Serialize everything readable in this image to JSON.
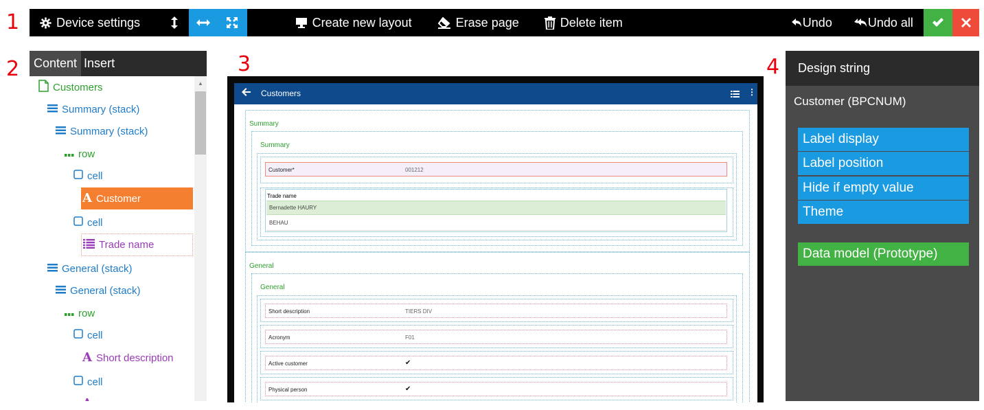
{
  "callouts": [
    "1",
    "2",
    "3",
    "4"
  ],
  "toolbar": {
    "device_settings": "Device settings",
    "create_layout": "Create new layout",
    "erase_page": "Erase page",
    "delete_item": "Delete item",
    "undo": "Undo",
    "undo_all": "Undo all"
  },
  "left_panel": {
    "tabs": [
      "Content",
      "Insert"
    ],
    "tree": [
      {
        "label": "Customers",
        "icon": "page-icon",
        "color": "#2ea02e"
      },
      {
        "label": "Summary (stack)",
        "icon": "stack-icon",
        "color": "#1f7cc9"
      },
      {
        "label": "Summary (stack)",
        "icon": "stack-icon",
        "color": "#1f7cc9"
      },
      {
        "label": "row",
        "icon": "row-icon",
        "color": "#2ea02e"
      },
      {
        "label": "cell",
        "icon": "cell-icon",
        "color": "#1f7cc9"
      },
      {
        "label": "Customer",
        "icon": "text-field-icon",
        "color": "#ffffff",
        "selected_bg": "#f47f31"
      },
      {
        "label": "cell",
        "icon": "cell-icon",
        "color": "#1f7cc9"
      },
      {
        "label": "Trade name",
        "icon": "list-field-icon",
        "color": "#9a3bb8"
      },
      {
        "label": "General (stack)",
        "icon": "stack-icon",
        "color": "#1f7cc9"
      },
      {
        "label": "General (stack)",
        "icon": "stack-icon",
        "color": "#1f7cc9"
      },
      {
        "label": "row",
        "icon": "row-icon",
        "color": "#2ea02e"
      },
      {
        "label": "cell",
        "icon": "cell-icon",
        "color": "#1f7cc9"
      },
      {
        "label": "Short description",
        "icon": "text-field-icon",
        "color": "#9a3bb8"
      },
      {
        "label": "cell",
        "icon": "cell-icon",
        "color": "#1f7cc9"
      }
    ]
  },
  "preview": {
    "app_title": "Customers",
    "summary_outer": "Summary",
    "summary_inner": "Summary",
    "customer_label": "Customer*",
    "customer_value": "001212",
    "trade_name_label": "Trade name",
    "trade_rows": [
      "Bernadette HAURY",
      "BEHAU"
    ],
    "general_outer": "General",
    "general_inner": "General",
    "fields": [
      {
        "label": "Short description",
        "value": "TIERS DIV"
      },
      {
        "label": "Acronym",
        "value": "F01"
      },
      {
        "label": "Active customer",
        "value": "✔"
      },
      {
        "label": "Physical person",
        "value": "✔"
      }
    ]
  },
  "right_panel": {
    "title": "Design string",
    "subtitle": "Customer (BPCNUM)",
    "options": [
      "Label display",
      "Label position",
      "Hide if empty value",
      "Theme"
    ],
    "data_model": "Data model (Prototype)"
  },
  "colors": {
    "accent_blue": "#1a9ae0",
    "confirm_green": "#43b245",
    "cancel_red": "#ee4b3b",
    "selected_orange": "#f47f31",
    "app_bar": "#0f4a8c"
  }
}
